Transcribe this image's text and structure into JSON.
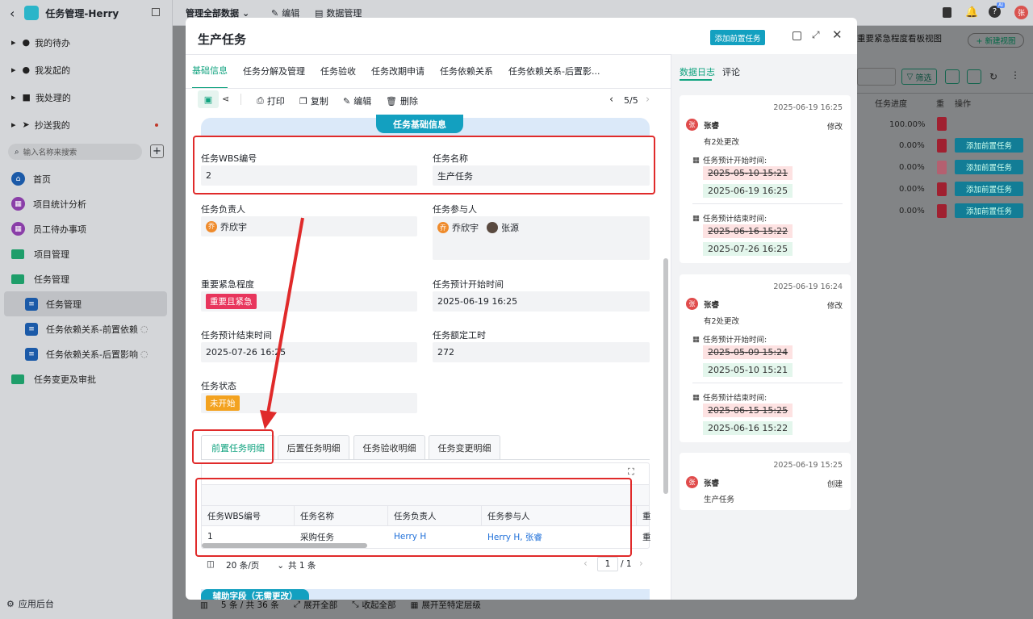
{
  "app": {
    "title": "任务管理-Herry",
    "avatar_text": "张"
  },
  "header": {
    "dropdown": "管理全部数据",
    "edit": "编辑",
    "data_mgmt": "数据管理",
    "ai_badge": "AI"
  },
  "sidebar": {
    "items": [
      {
        "label": "我的待办"
      },
      {
        "label": "我发起的"
      },
      {
        "label": "我处理的"
      },
      {
        "label": "抄送我的"
      }
    ],
    "search_placeholder": "输入名称来搜索",
    "nav": [
      {
        "label": "首页"
      },
      {
        "label": "项目统计分析"
      },
      {
        "label": "员工待办事项"
      },
      {
        "label": "项目管理"
      },
      {
        "label": "任务管理"
      },
      {
        "label": "任务管理"
      },
      {
        "label": "任务依赖关系-前置依赖"
      },
      {
        "label": "任务依赖关系-后置影响"
      },
      {
        "label": "任务变更及审批"
      }
    ],
    "footer": "应用后台"
  },
  "bg_view": {
    "view_name": "重要紧急程度看板视图",
    "new_view": "+ 新建视图",
    "filter": "筛选",
    "col_progress": "任务进度",
    "col_imp": "重",
    "col_action": "操作",
    "progress": [
      "100.00%",
      "0.00%",
      "0.00%",
      "0.00%",
      "0.00%"
    ],
    "add_pre": "添加前置任务",
    "footer_count": "5 条 / 共 36 条",
    "expand_all": "展开全部",
    "collapse_all": "收起全部",
    "expand_level": "展开至特定层级"
  },
  "modal": {
    "title": "生产任务",
    "add_pre_button": "添加前置任务",
    "tabs": [
      "基础信息",
      "任务分解及管理",
      "任务验收",
      "任务改期申请",
      "任务依赖关系",
      "任务依赖关系-后置影..."
    ],
    "toolbar": {
      "print": "打印",
      "copy": "复制",
      "edit": "编辑",
      "delete": "删除",
      "pager": "5/5"
    },
    "section_title": "任务基础信息",
    "fields": {
      "wbs_label": "任务WBS编号",
      "wbs_value": "2",
      "name_label": "任务名称",
      "name_value": "生产任务",
      "owner_label": "任务负责人",
      "owner": "乔欣宇",
      "owner_avatar": "乔",
      "participants_label": "任务参与人",
      "participant1": "乔欣宇",
      "participant1_avatar": "乔",
      "participant2": "张源",
      "priority_label": "重要紧急程度",
      "priority_value": "重要且紧急",
      "start_label": "任务预计开始时间",
      "start_value": "2025-06-19 16:25",
      "end_label": "任务预计结束时间",
      "end_value": "2025-07-26 16:25",
      "hours_label": "任务额定工时",
      "hours_value": "272",
      "status_label": "任务状态",
      "status_value": "未开始"
    },
    "subtabs": [
      "前置任务明细",
      "后置任务明细",
      "任务验收明细",
      "任务变更明细"
    ],
    "table": {
      "headers": [
        "任务WBS编号",
        "任务名称",
        "任务负责人",
        "任务参与人",
        "重"
      ],
      "row": {
        "wbs": "1",
        "name": "采购任务",
        "owner": "Herry H",
        "participants": "Herry H, 张睿",
        "imp": "重"
      },
      "page_size": "20 条/页",
      "total": "共 1 条",
      "page": "1",
      "pages": "/ 1"
    },
    "aux_section": "辅助字段（无需更改）",
    "right_tabs": [
      "数据日志",
      "评论"
    ],
    "logs": [
      {
        "time": "2025-06-19 16:25",
        "user": "张睿",
        "user_avatar": "张",
        "action": "修改",
        "summary": "有2处更改",
        "f1": "任务预计开始时间:",
        "f1_old": "2025-05-10 15:21",
        "f1_new": "2025-06-19 16:25",
        "f2": "任务预计结束时间:",
        "f2_old": "2025-06-16 15:22",
        "f2_new": "2025-07-26 16:25"
      },
      {
        "time": "2025-06-19 16:24",
        "user": "张睿",
        "user_avatar": "张",
        "action": "修改",
        "summary": "有2处更改",
        "f1": "任务预计开始时间:",
        "f1_old": "2025-05-09 15:24",
        "f1_new": "2025-05-10 15:21",
        "f2": "任务预计结束时间:",
        "f2_old": "2025-06-15 15:25",
        "f2_new": "2025-06-16 15:22"
      },
      {
        "time": "2025-06-19 15:25",
        "user": "张睿",
        "user_avatar": "张",
        "action": "创建",
        "summary": "生产任务"
      }
    ]
  }
}
